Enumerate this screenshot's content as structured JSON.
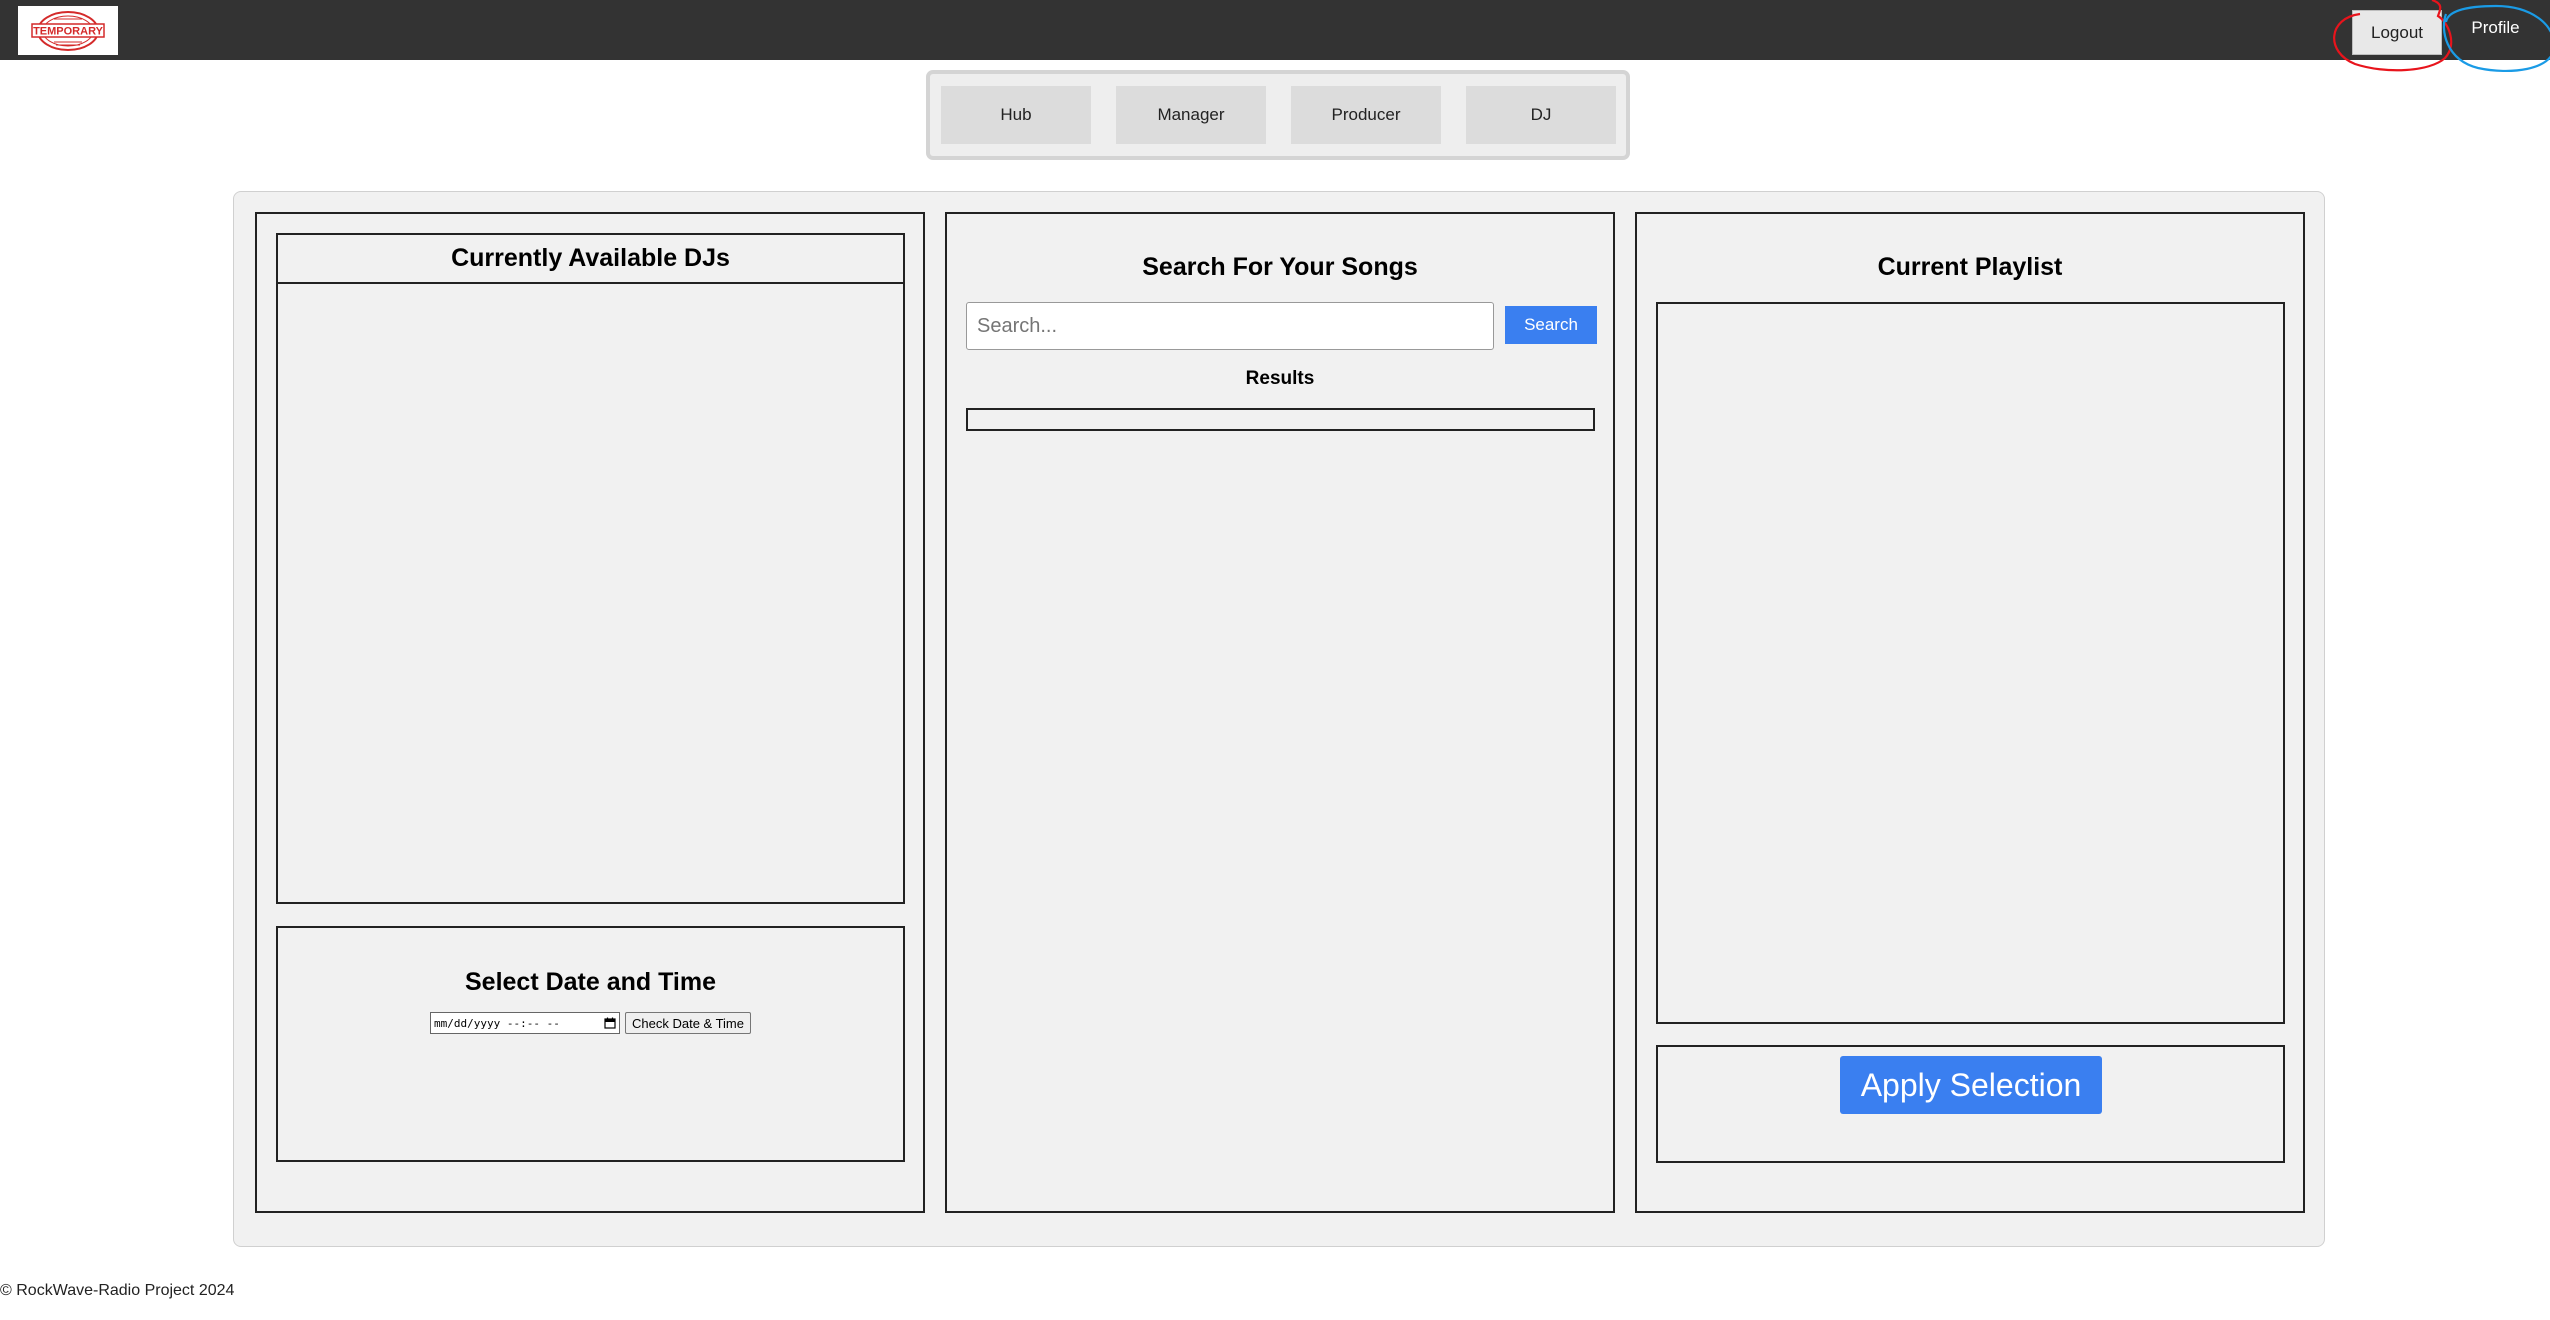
{
  "header": {
    "logo_text": "TEMPORARY",
    "logout_label": "Logout",
    "profile_label": "Profile"
  },
  "nav": {
    "items": [
      {
        "label": "Hub"
      },
      {
        "label": "Manager"
      },
      {
        "label": "Producer"
      },
      {
        "label": "DJ"
      }
    ]
  },
  "left": {
    "djs_title": "Currently Available DJs",
    "date_title": "Select Date and Time",
    "date_placeholder": "mm/dd/yyyy --:-- --",
    "check_label": "Check Date & Time"
  },
  "middle": {
    "title": "Search For Your Songs",
    "search_placeholder": "Search...",
    "search_value": "",
    "search_label": "Search",
    "results_label": "Results"
  },
  "right": {
    "title": "Current Playlist",
    "apply_label": "Apply Selection"
  },
  "footer": {
    "text": "© RockWave-Radio Project 2024"
  },
  "colors": {
    "topbar": "#333333",
    "accent_blue": "#3a7ff0",
    "annotation_red": "#e8141c",
    "annotation_blue": "#1a9be6"
  }
}
